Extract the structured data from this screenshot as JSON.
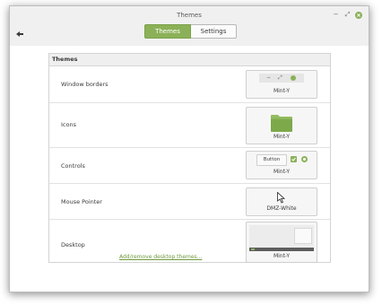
{
  "window": {
    "title": "Themes",
    "minimize_glyph": "−",
    "maximize_glyph": "⤢",
    "close_icon": "close-icon",
    "back_icon": "back-arrow-icon"
  },
  "tabs": [
    {
      "label": "Themes",
      "active": true
    },
    {
      "label": "Settings",
      "active": false
    }
  ],
  "panel": {
    "header": "Themes",
    "rows": [
      {
        "label": "Window borders",
        "value": "Mint-Y"
      },
      {
        "label": "Icons",
        "value": "Mint-Y"
      },
      {
        "label": "Controls",
        "value": "Mint-Y",
        "preview_button": "Button"
      },
      {
        "label": "Mouse Pointer",
        "value": "DMZ-White"
      },
      {
        "label": "Desktop",
        "value": "Mint-Y"
      }
    ],
    "add_link": "Add/remove desktop themes..."
  },
  "colors": {
    "accent": "#8bb158",
    "link": "#6f9a3e",
    "folder": "#7da94b"
  }
}
